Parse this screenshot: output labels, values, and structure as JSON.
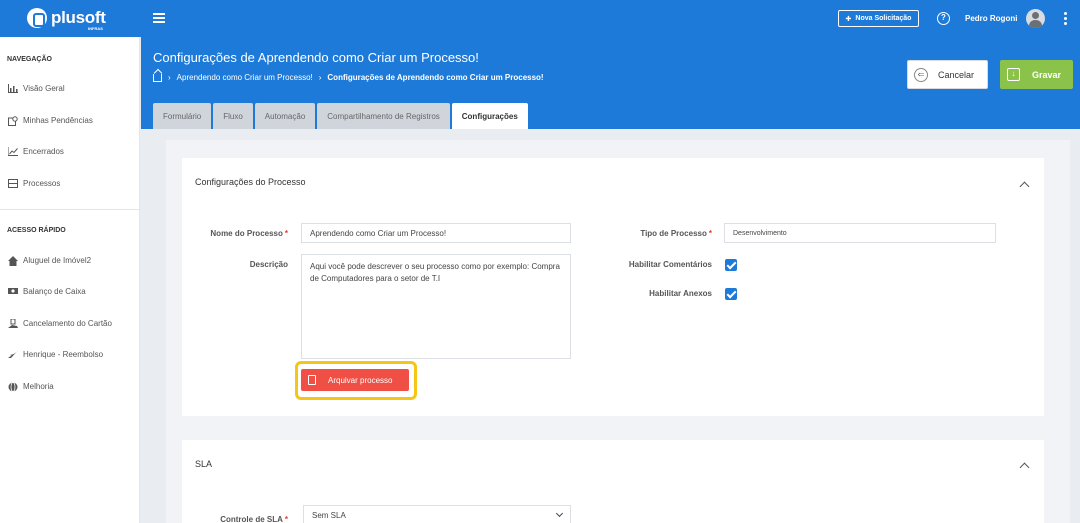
{
  "header": {
    "logo_text": "plusoft",
    "logo_sub": "INFRAS",
    "new_request_label": "Nova Solicitação",
    "user_name": "Pedro Rogoni"
  },
  "sidebar": {
    "nav_title": "NAVEGAÇÃO",
    "nav_items": [
      {
        "label": "Visão Geral",
        "icon": "bar-chart-icon"
      },
      {
        "label": "Minhas Pendências",
        "icon": "user-tasks-icon"
      },
      {
        "label": "Encerrados",
        "icon": "line-chart-icon"
      },
      {
        "label": "Processos",
        "icon": "inbox-icon"
      }
    ],
    "quick_title": "ACESSO RÁPIDO",
    "quick_items": [
      {
        "label": "Aluguel de Imóvel2",
        "icon": "home-icon"
      },
      {
        "label": "Balanço de Caixa",
        "icon": "money-icon"
      },
      {
        "label": "Cancelamento do Cartão",
        "icon": "hand-card-icon"
      },
      {
        "label": "Henrique - Reembolso",
        "icon": "plane-icon"
      },
      {
        "label": "Melhoria",
        "icon": "globe-icon"
      }
    ]
  },
  "page": {
    "title": "Configurações de Aprendendo como Criar um Processo!",
    "breadcrumb": [
      "Aprendendo como Criar um Processo!",
      "Configurações de Aprendendo como Criar um Processo!"
    ],
    "cancel_label": "Cancelar",
    "save_label": "Gravar"
  },
  "tabs": [
    "Formulário",
    "Fluxo",
    "Automação",
    "Compartilhamento de Registros",
    "Configurações"
  ],
  "active_tab": "Configurações",
  "process_settings": {
    "title": "Configurações do Processo",
    "name_label": "Nome do Processo",
    "name_value": "Aprendendo como Criar um Processo!",
    "description_label": "Descrição",
    "description_value": "Aqui você pode descrever o seu processo como por exemplo: Compra de Computadores para o setor de T.I",
    "type_label": "Tipo de Processo",
    "type_value": "Desenvolvimento",
    "comments_label": "Habilitar Comentários",
    "comments_enabled": true,
    "attachments_label": "Habilitar Anexos",
    "attachments_enabled": true,
    "archive_label": "Arquivar processo"
  },
  "sla": {
    "title": "SLA",
    "control_label": "Controle de SLA",
    "control_value": "Sem SLA"
  },
  "colors": {
    "primary": "#1e7ad9",
    "save": "#8bc34a",
    "archive": "#ef4f45",
    "highlight": "#f5c518"
  }
}
